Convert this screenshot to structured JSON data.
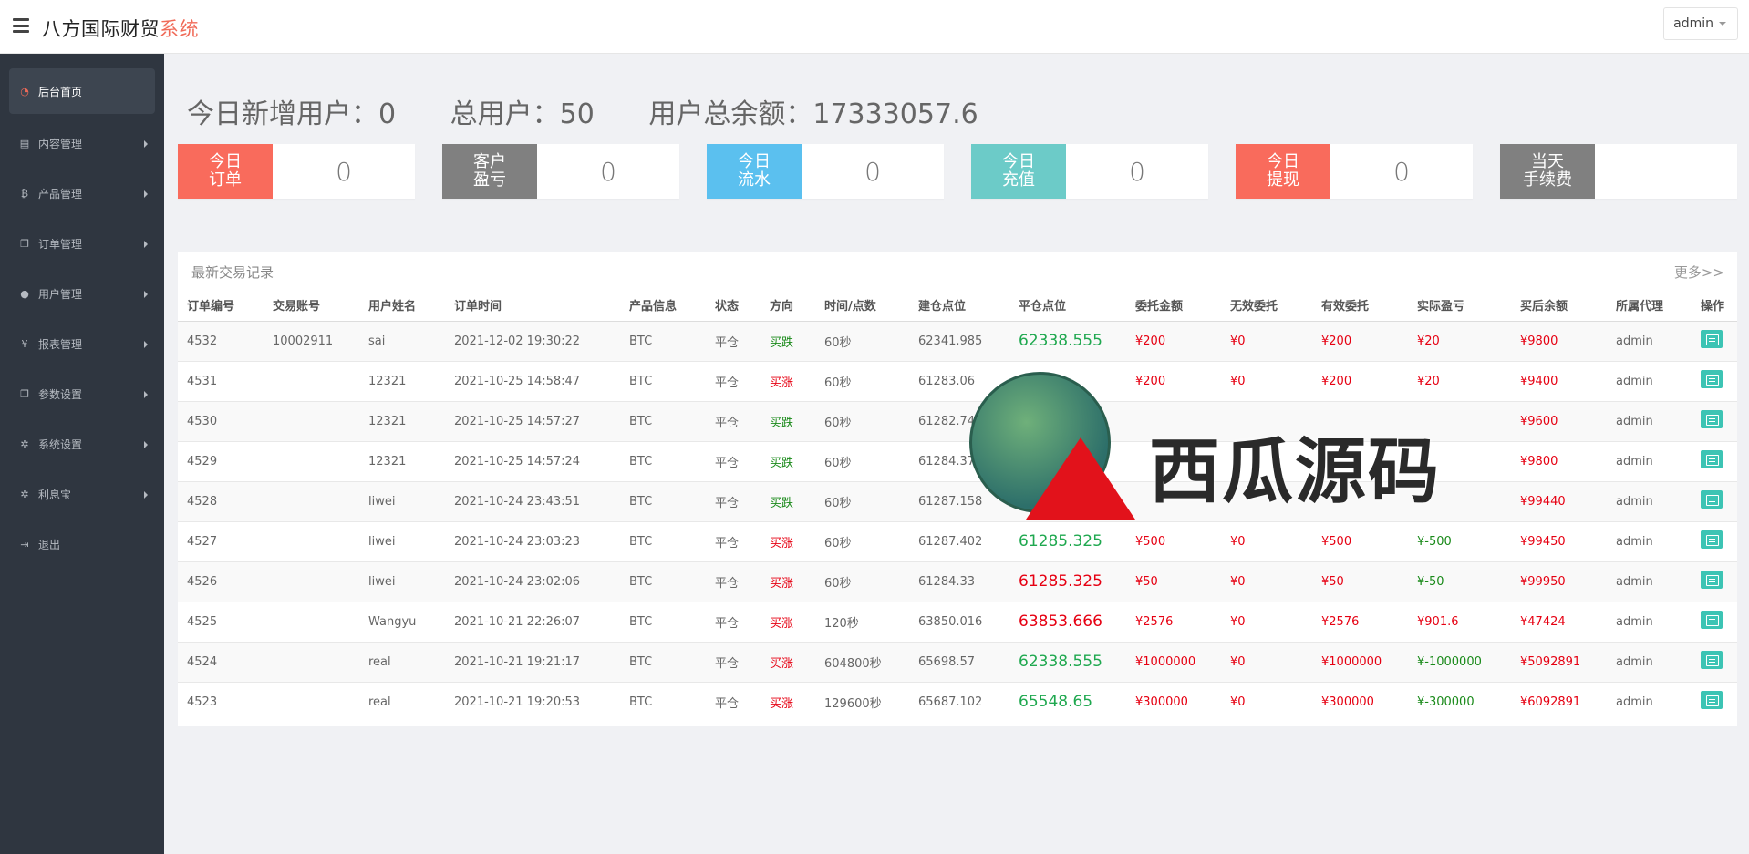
{
  "header": {
    "brand_main": "八方国际财贸",
    "brand_accent": "系统",
    "user": "admin"
  },
  "sidebar": {
    "items": [
      {
        "label": "后台首页",
        "icon": "dashboard-icon",
        "active": true
      },
      {
        "label": "内容管理",
        "icon": "book-icon"
      },
      {
        "label": "产品管理",
        "icon": "bitcoin-icon"
      },
      {
        "label": "订单管理",
        "icon": "copy-icon"
      },
      {
        "label": "用户管理",
        "icon": "user-icon"
      },
      {
        "label": "报表管理",
        "icon": "yen-icon"
      },
      {
        "label": "参数设置",
        "icon": "copy-icon"
      },
      {
        "label": "系统设置",
        "icon": "gears-icon"
      },
      {
        "label": "利息宝",
        "icon": "gears-icon"
      },
      {
        "label": "退出",
        "icon": "signout-icon"
      }
    ]
  },
  "summary": {
    "new_users": "今日新增用户：0",
    "total_users": "总用户：50",
    "total_balance": "用户总余额：17333057.6"
  },
  "stats": [
    {
      "label": "今日订单",
      "value": "0",
      "color": "#f96b5c"
    },
    {
      "label": "客户盈亏",
      "value": "0",
      "color": "#808080"
    },
    {
      "label": "今日流水",
      "value": "0",
      "color": "#5bc0ef"
    },
    {
      "label": "今日充值",
      "value": "0",
      "color": "#6ccbc8"
    },
    {
      "label": "今日提现",
      "value": "0",
      "color": "#f96b5c"
    },
    {
      "label": "当天手续费",
      "value": "",
      "color": "#808080"
    }
  ],
  "panel": {
    "title": "最新交易记录",
    "more": "更多>>",
    "columns": [
      "订单编号",
      "交易账号",
      "用户姓名",
      "订单时间",
      "产品信息",
      "状态",
      "方向",
      "时间/点数",
      "建仓点位",
      "平仓点位",
      "委托金额",
      "无效委托",
      "有效委托",
      "实际盈亏",
      "买后余额",
      "所属代理",
      "操作"
    ],
    "rows": [
      [
        "4532",
        "10002911",
        "sai",
        "2021-12-02 19:30:22",
        "BTC",
        "平仓",
        "买跌",
        "60秒",
        "62341.985",
        "62338.555",
        "¥200",
        "¥0",
        "¥200",
        "¥20",
        "¥9800",
        "admin"
      ],
      [
        "4531",
        "",
        "12321",
        "2021-10-25 14:58:47",
        "BTC",
        "平仓",
        "买涨",
        "60秒",
        "61283.06",
        "",
        "¥200",
        "¥0",
        "¥200",
        "¥20",
        "¥9400",
        "admin"
      ],
      [
        "4530",
        "",
        "12321",
        "2021-10-25 14:57:27",
        "BTC",
        "平仓",
        "买跌",
        "60秒",
        "61282.745",
        "",
        "",
        "",
        "",
        "",
        "¥9600",
        "admin"
      ],
      [
        "4529",
        "",
        "12321",
        "2021-10-25 14:57:24",
        "BTC",
        "平仓",
        "买跌",
        "60秒",
        "61284.37",
        "",
        "",
        "",
        "",
        "",
        "¥9800",
        "admin"
      ],
      [
        "4528",
        "",
        "liwei",
        "2021-10-24 23:43:51",
        "BTC",
        "平仓",
        "买跌",
        "60秒",
        "61287.158",
        "",
        "",
        "",
        "",
        "",
        "¥99440",
        "admin"
      ],
      [
        "4527",
        "",
        "liwei",
        "2021-10-24 23:03:23",
        "BTC",
        "平仓",
        "买涨",
        "60秒",
        "61287.402",
        "61285.325",
        "¥500",
        "¥0",
        "¥500",
        "¥-500",
        "¥99450",
        "admin"
      ],
      [
        "4526",
        "",
        "liwei",
        "2021-10-24 23:02:06",
        "BTC",
        "平仓",
        "买涨",
        "60秒",
        "61284.33",
        "61285.325",
        "¥50",
        "¥0",
        "¥50",
        "¥-50",
        "¥99950",
        "admin"
      ],
      [
        "4525",
        "",
        "Wangyu",
        "2021-10-21 22:26:07",
        "BTC",
        "平仓",
        "买涨",
        "120秒",
        "63850.016",
        "63853.666",
        "¥2576",
        "¥0",
        "¥2576",
        "¥901.6",
        "¥47424",
        "admin"
      ],
      [
        "4524",
        "",
        "real",
        "2021-10-21 19:21:17",
        "BTC",
        "平仓",
        "买涨",
        "604800秒",
        "65698.57",
        "62338.555",
        "¥1000000",
        "¥0",
        "¥1000000",
        "¥-1000000",
        "¥5092891",
        "admin"
      ],
      [
        "4523",
        "",
        "real",
        "2021-10-21 19:20:53",
        "BTC",
        "平仓",
        "买涨",
        "129600秒",
        "65687.102",
        "65548.65",
        "¥300000",
        "¥0",
        "¥300000",
        "¥-300000",
        "¥6092891",
        "admin"
      ]
    ],
    "close_colors": [
      "green",
      "red",
      "",
      "",
      "",
      "green",
      "red",
      "red",
      "green",
      "green"
    ],
    "pnl_colors": [
      "red",
      "red",
      "",
      "",
      "",
      "green",
      "green",
      "red",
      "green",
      "green"
    ]
  },
  "watermark": {
    "text": "西瓜源码"
  }
}
